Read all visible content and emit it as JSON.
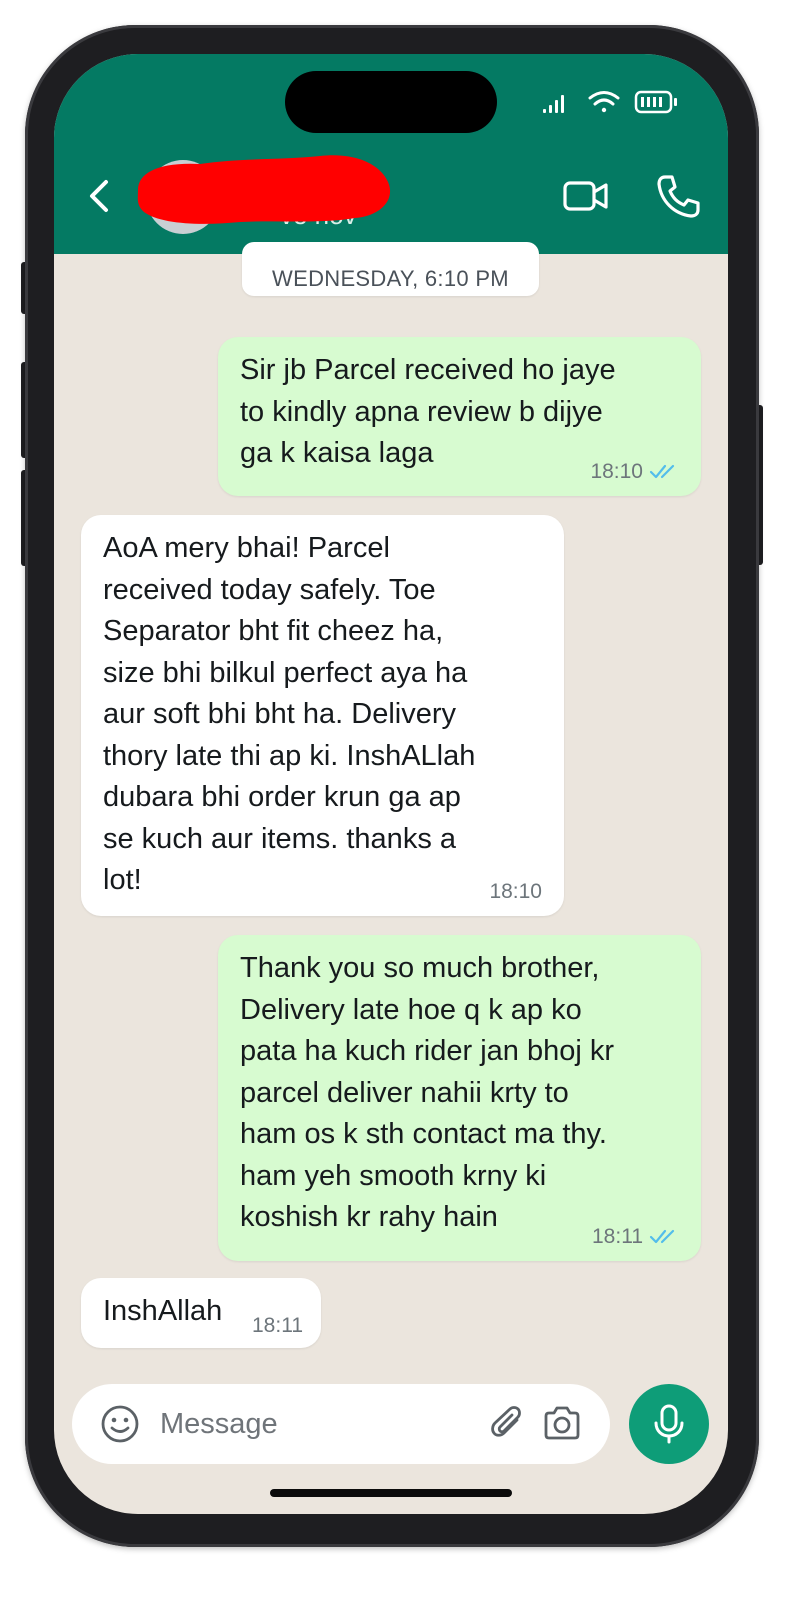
{
  "header": {
    "contact_status": "ve nov",
    "background_color": "#047a63",
    "icons": [
      "back-arrow-icon",
      "video-call-icon",
      "phone-call-icon"
    ]
  },
  "status_bar": {
    "icons": [
      "signal-icon",
      "wifi-icon",
      "battery-icon"
    ]
  },
  "chat": {
    "date_separator": "WEDNESDAY, 6:10 PM",
    "messages": [
      {
        "direction": "outgoing",
        "text": "Sir jb Parcel received ho jaye\nto kindly apna review b dijye\nga k kaisa laga",
        "time": "18:10",
        "status": "read"
      },
      {
        "direction": "incoming",
        "text": "AoA mery bhai! Parcel\nreceived today safely. Toe\nSeparator bht fit cheez ha,\nsize bhi bilkul perfect aya ha\naur soft bhi bht ha. Delivery\nthory late thi ap ki. InshALlah\ndubara bhi order krun ga ap\nse kuch aur items. thanks a\nlot!",
        "time": "18:10"
      },
      {
        "direction": "outgoing",
        "text": "Thank you so much brother,\nDelivery late hoe q k ap ko\npata ha kuch rider jan bhoj kr\nparcel deliver nahii krty to\nham os k sth contact ma thy.\nham yeh smooth krny ki\nkoshish kr rahy hain",
        "time": "18:11",
        "status": "read"
      },
      {
        "direction": "incoming",
        "text": "InshAllah",
        "time": "18:11"
      }
    ]
  },
  "composer": {
    "placeholder": "Message",
    "icons": [
      "emoji-icon",
      "attach-icon",
      "camera-icon",
      "microphone-icon"
    ],
    "mic_color": "#0e9d78"
  },
  "colors": {
    "outgoing_bubble": "#d7fbd0",
    "incoming_bubble": "#ffffff",
    "chat_background": "#ebe5dd",
    "read_ticks": "#53bdeb"
  }
}
